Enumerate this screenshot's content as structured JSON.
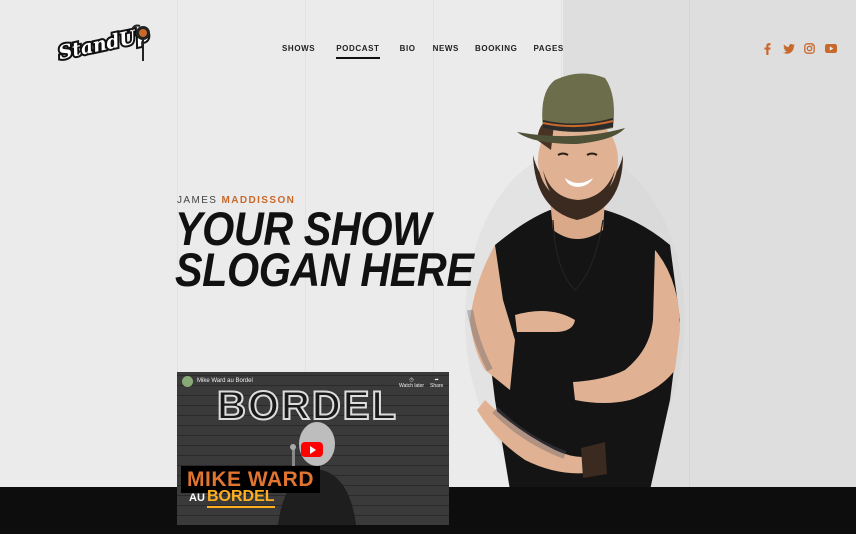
{
  "brand": {
    "logo_text": "StandUp"
  },
  "nav": {
    "items": [
      {
        "label": "SHOWS",
        "active": false
      },
      {
        "label": "PODCAST",
        "active": true
      },
      {
        "label": "BIO",
        "active": false
      },
      {
        "label": "NEWS",
        "active": false
      },
      {
        "label": "BOOKING",
        "active": false
      },
      {
        "label": "PAGES",
        "active": false
      }
    ]
  },
  "social": {
    "icons": [
      "facebook-icon",
      "twitter-icon",
      "instagram-icon",
      "youtube-icon"
    ],
    "color": "#c8692c"
  },
  "hero": {
    "first_name": "JAMES",
    "last_name": "MADDISSON",
    "headline_line1": "YOUR SHOW",
    "headline_line2": "SLOGAN HERE"
  },
  "video": {
    "title": "Mike Ward au Bordel",
    "watch_later": "Watch later",
    "share": "Share",
    "sign_text": "BORDEL",
    "name_text": "MIKE WARD",
    "sub_au": "AU",
    "sub_bordel": "BORDEL"
  },
  "colors": {
    "accent": "#c8692c",
    "dark": "#111111",
    "background": "#ebebeb"
  }
}
